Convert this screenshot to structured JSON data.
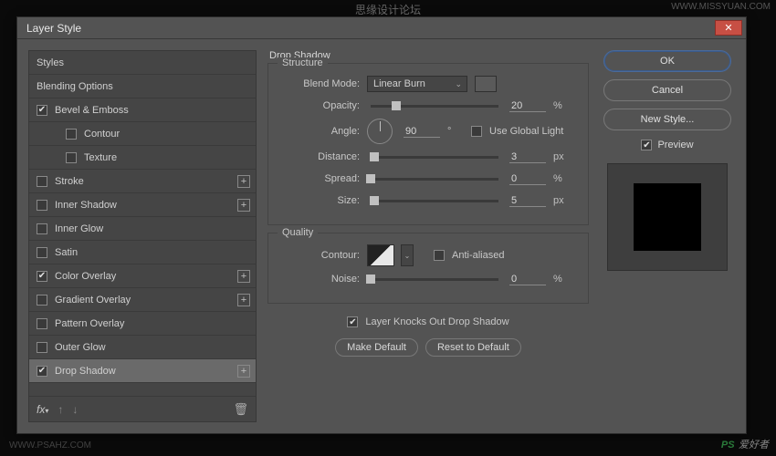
{
  "watermarks": {
    "top": "思缘设计论坛",
    "top_right": "WWW.MISSYUAN.COM",
    "bottom_left": "WWW.PSAHZ.COM",
    "bottom_right_ps": "PS",
    "bottom_right_text": "爱好者"
  },
  "dialog": {
    "title": "Layer Style"
  },
  "sidebar": {
    "styles": "Styles",
    "blending": "Blending Options",
    "bevel": "Bevel & Emboss",
    "contour": "Contour",
    "texture": "Texture",
    "stroke": "Stroke",
    "inner_shadow": "Inner Shadow",
    "inner_glow": "Inner Glow",
    "satin": "Satin",
    "color_overlay": "Color Overlay",
    "gradient_overlay": "Gradient Overlay",
    "pattern_overlay": "Pattern Overlay",
    "outer_glow": "Outer Glow",
    "drop_shadow": "Drop Shadow"
  },
  "panel": {
    "title": "Drop Shadow",
    "structure": {
      "title": "Structure",
      "blend_mode_label": "Blend Mode:",
      "blend_mode_value": "Linear Burn",
      "opacity_label": "Opacity:",
      "opacity_value": "20",
      "opacity_unit": "%",
      "angle_label": "Angle:",
      "angle_value": "90",
      "angle_unit": "°",
      "global_light": "Use Global Light",
      "distance_label": "Distance:",
      "distance_value": "3",
      "distance_unit": "px",
      "spread_label": "Spread:",
      "spread_value": "0",
      "spread_unit": "%",
      "size_label": "Size:",
      "size_value": "5",
      "size_unit": "px"
    },
    "quality": {
      "title": "Quality",
      "contour_label": "Contour:",
      "antialiased": "Anti-aliased",
      "noise_label": "Noise:",
      "noise_value": "0",
      "noise_unit": "%"
    },
    "knockout": "Layer Knocks Out Drop Shadow",
    "make_default": "Make Default",
    "reset_default": "Reset to Default"
  },
  "right": {
    "ok": "OK",
    "cancel": "Cancel",
    "new_style": "New Style...",
    "preview": "Preview"
  }
}
